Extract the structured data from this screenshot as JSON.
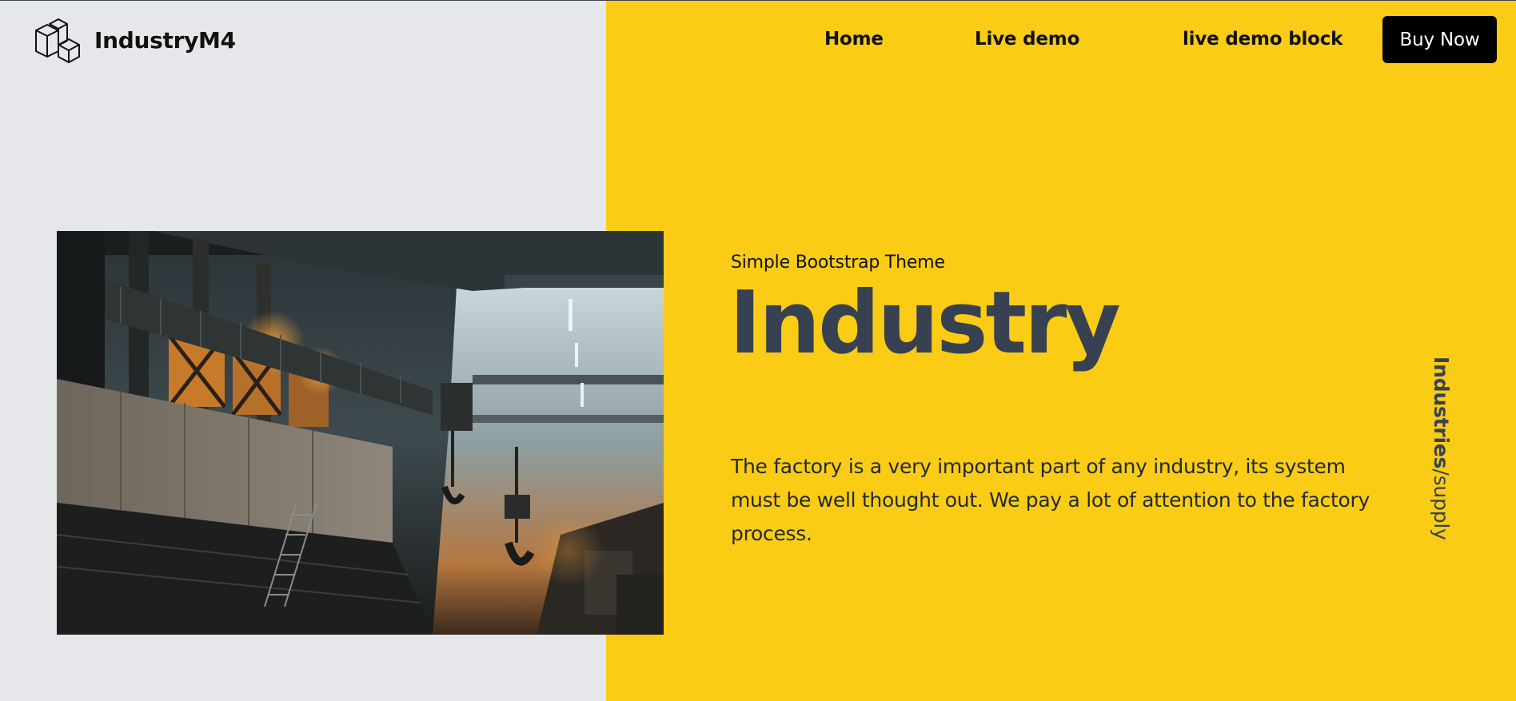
{
  "brand": {
    "name": "IndustryM4",
    "icon": "cubes-logo-icon"
  },
  "nav": {
    "items": [
      {
        "label": "Home"
      },
      {
        "label": "Live demo"
      },
      {
        "label": "live demo block"
      }
    ],
    "cta_label": "Buy Now"
  },
  "hero": {
    "eyebrow": "Simple Bootstrap Theme",
    "title": "Industry",
    "description": "The factory is a very important part of any industry, its system must be well thought out. We pay a lot of attention to the factory process.",
    "side_label_bold": "Industries",
    "side_label_sep": "/",
    "side_label_light": "supply"
  },
  "colors": {
    "left_background": "#e5e7eb",
    "accent_yellow": "#facc15",
    "title_gray": "#374151",
    "button_black": "#000000"
  }
}
